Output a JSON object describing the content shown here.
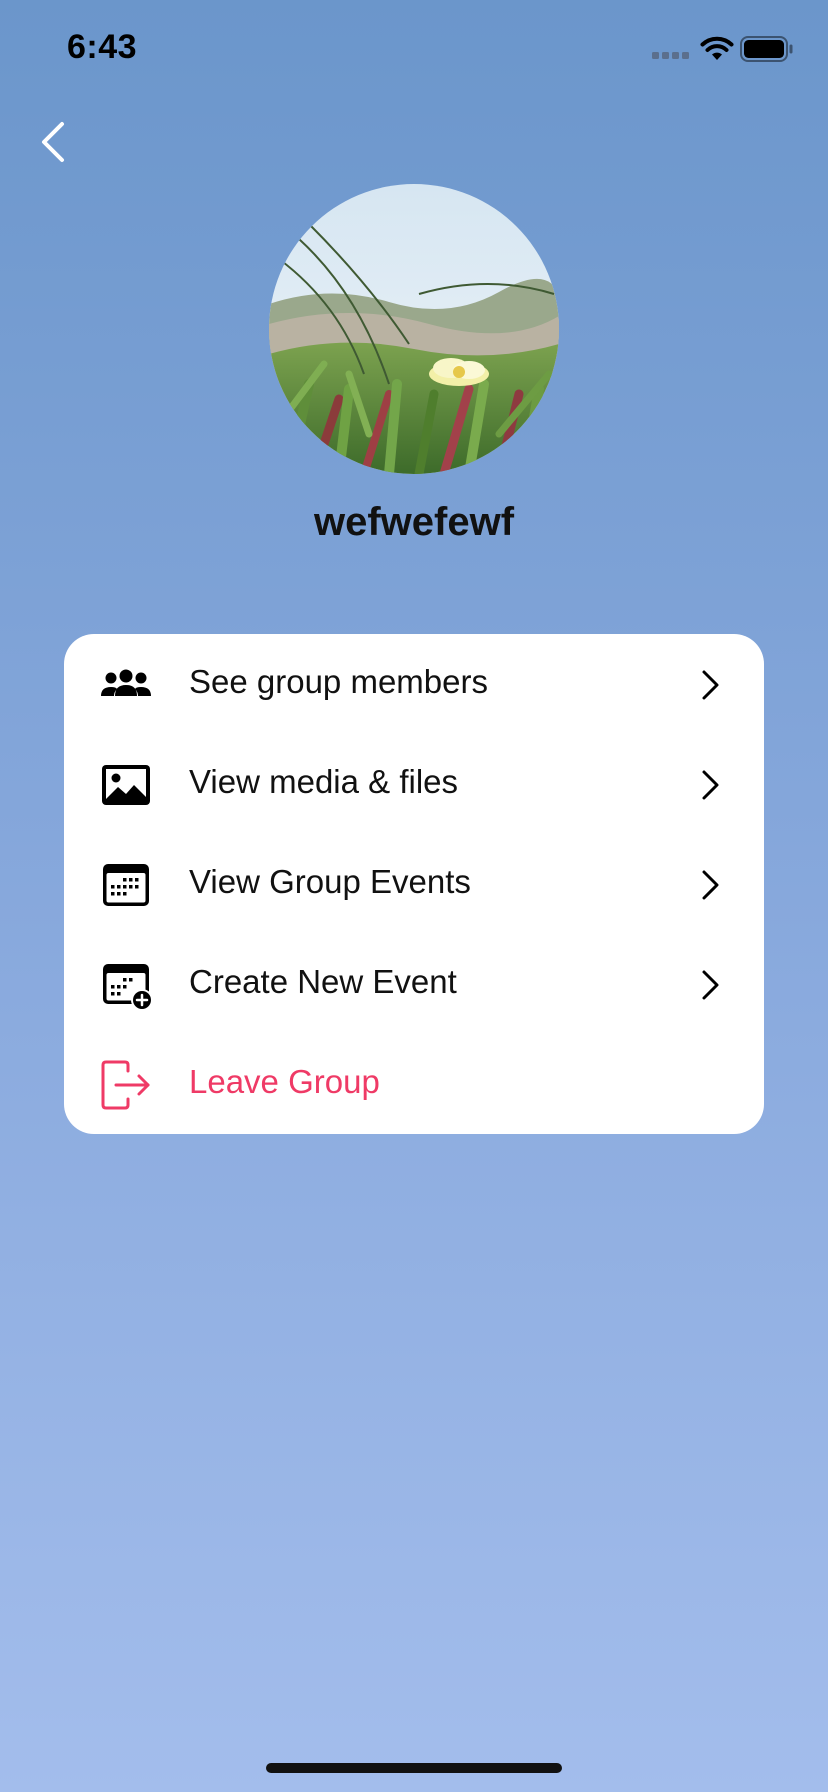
{
  "status_bar": {
    "time": "6:43"
  },
  "navigation": {
    "back_icon": "chevron-left-icon"
  },
  "group": {
    "name": "wefwefewf",
    "avatar": "ice-plant-flower-photo"
  },
  "menu": {
    "items": [
      {
        "label": "See group members",
        "icon": "group-members-icon",
        "chevron": true
      },
      {
        "label": "View media & files",
        "icon": "image-icon",
        "chevron": true
      },
      {
        "label": "View Group Events",
        "icon": "calendar-icon",
        "chevron": true
      },
      {
        "label": "Create New Event",
        "icon": "calendar-add-icon",
        "chevron": true
      },
      {
        "label": "Leave Group",
        "icon": "leave-icon",
        "chevron": false
      }
    ]
  },
  "colors": {
    "background_top": "#6b96cb",
    "background_bottom": "#a3bdec",
    "card": "#ffffff",
    "danger": "#ef3a66",
    "text": "#111111"
  }
}
